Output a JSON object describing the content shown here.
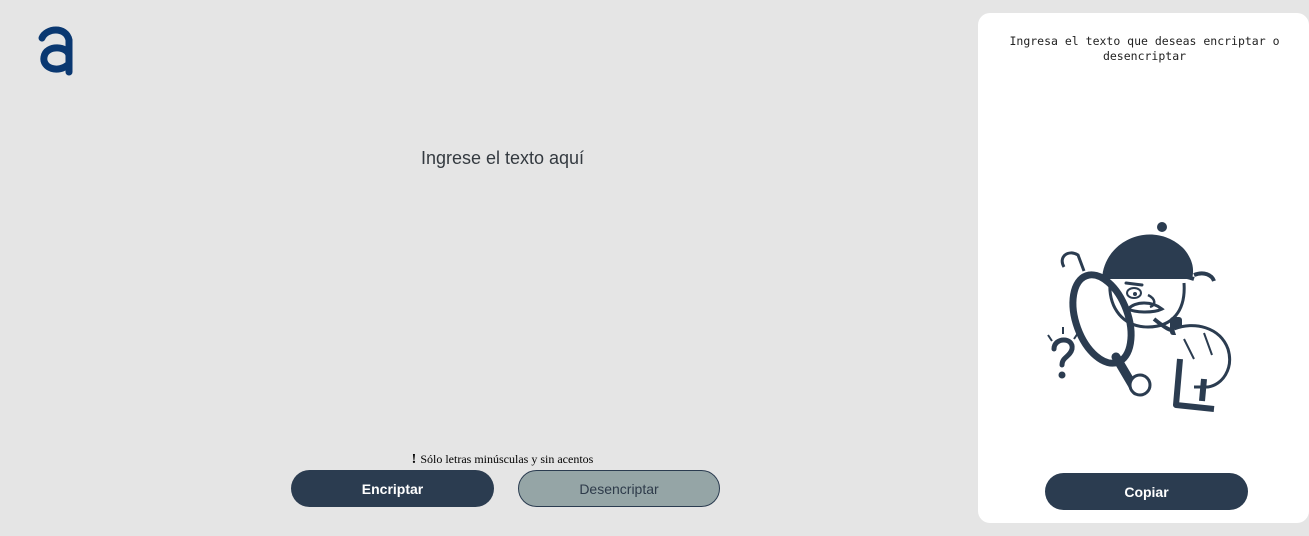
{
  "input": {
    "placeholder": "Ingrese el texto aquí"
  },
  "warning": {
    "icon": "!",
    "text": "Sólo letras minúsculas y sin acentos"
  },
  "buttons": {
    "encrypt_label": "Encriptar",
    "decrypt_label": "Desencriptar",
    "copy_label": "Copiar"
  },
  "panel": {
    "message": "Ingresa el texto que deseas encriptar o desencriptar",
    "illustration_icon": "detective-magnifier-icon"
  },
  "colors": {
    "background": "#e5e5e5",
    "primary_dark": "#2b3c50",
    "secondary_gray": "#95a5a6",
    "logo_blue": "#0a3871",
    "panel_bg": "#ffffff"
  }
}
